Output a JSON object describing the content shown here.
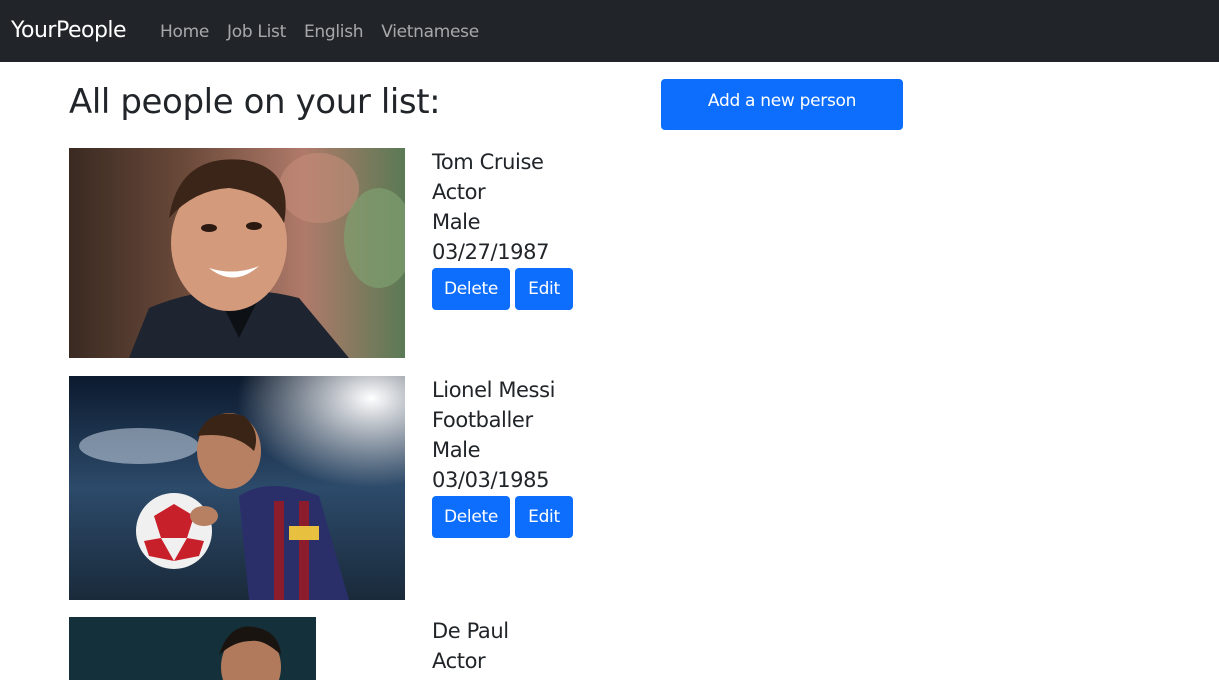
{
  "navbar": {
    "brand": "YourPeople",
    "links": [
      "Home",
      "Job List",
      "English",
      "Vietnamese"
    ]
  },
  "main": {
    "title": "All people on your list:",
    "add_button": "Add a new person"
  },
  "people": [
    {
      "name": "Tom Cruise",
      "job": "Actor",
      "gender": "Male",
      "dob": "03/27/1987",
      "delete_label": "Delete",
      "edit_label": "Edit"
    },
    {
      "name": "Lionel Messi",
      "job": "Footballer",
      "gender": "Male",
      "dob": "03/03/1985",
      "delete_label": "Delete",
      "edit_label": "Edit"
    },
    {
      "name": "De Paul",
      "job": "Actor"
    }
  ]
}
